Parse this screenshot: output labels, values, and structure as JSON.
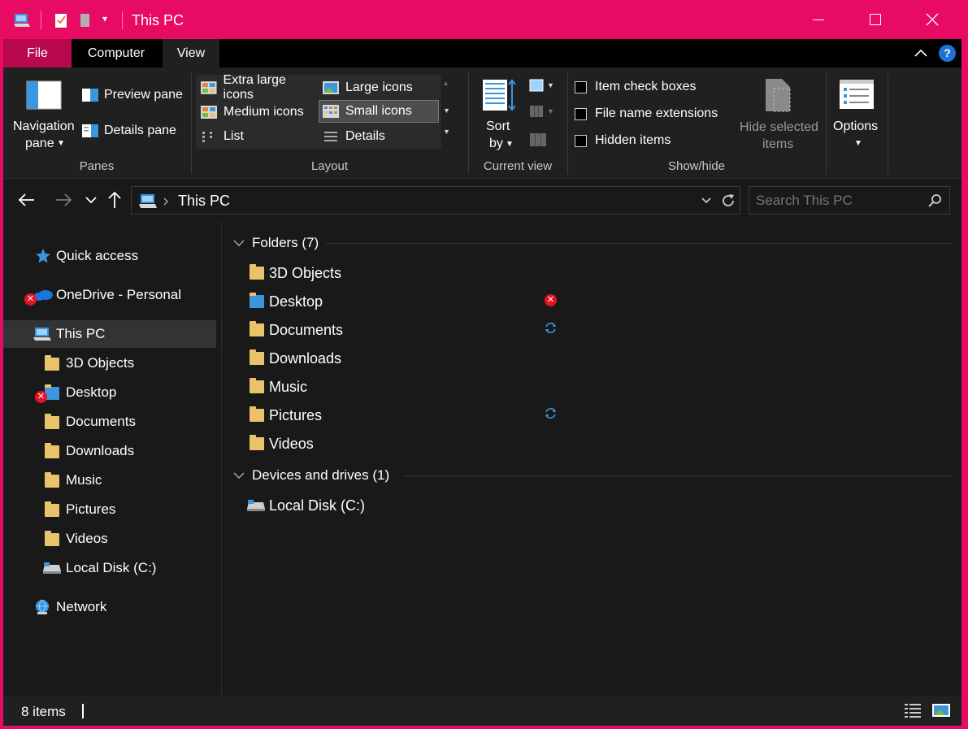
{
  "titlebar": {
    "title": "This PC",
    "minimize": "—",
    "maximize": "☐",
    "close": "✕"
  },
  "menu": {
    "tabs": [
      "File",
      "Computer",
      "View"
    ],
    "active_tab": "View"
  },
  "ribbon": {
    "panes": {
      "navigation_pane": "Navigation",
      "navigation_pane_2": "pane",
      "preview_pane": "Preview pane",
      "details_pane": "Details pane",
      "group_label": "Panes"
    },
    "layout": {
      "items": [
        "Extra large icons",
        "Large icons",
        "Medium icons",
        "Small icons",
        "List",
        "Details"
      ],
      "selected": "Small icons",
      "group_label": "Layout"
    },
    "current_view": {
      "sort_by": "Sort",
      "sort_by_2": "by",
      "group_label": "Current view"
    },
    "show_hide": {
      "item_check_boxes": "Item check boxes",
      "file_name_extensions": "File name extensions",
      "hidden_items": "Hidden items",
      "hide_selected": "Hide selected",
      "hide_selected_2": "items",
      "group_label": "Show/hide"
    },
    "options": {
      "label": "Options"
    }
  },
  "address": {
    "path": "This PC",
    "search_placeholder": "Search This PC"
  },
  "sidebar": {
    "items": [
      {
        "label": "Quick access",
        "icon": "star-icon"
      },
      {
        "label": "OneDrive - Personal",
        "icon": "cloud-icon",
        "status": "error"
      },
      {
        "label": "This PC",
        "icon": "computer-icon",
        "selected": true
      },
      {
        "label": "3D Objects",
        "icon": "folder-icon"
      },
      {
        "label": "Desktop",
        "icon": "folder-icon",
        "status": "error"
      },
      {
        "label": "Documents",
        "icon": "folder-icon"
      },
      {
        "label": "Downloads",
        "icon": "folder-icon"
      },
      {
        "label": "Music",
        "icon": "folder-icon"
      },
      {
        "label": "Pictures",
        "icon": "folder-icon"
      },
      {
        "label": "Videos",
        "icon": "folder-icon"
      },
      {
        "label": "Local Disk (C:)",
        "icon": "drive-icon"
      },
      {
        "label": "Network",
        "icon": "network-icon"
      }
    ]
  },
  "main": {
    "folders_header": "Folders (7)",
    "folders": [
      {
        "label": "3D Objects",
        "status": ""
      },
      {
        "label": "Desktop",
        "status": "error"
      },
      {
        "label": "Documents",
        "status": "sync"
      },
      {
        "label": "Downloads",
        "status": ""
      },
      {
        "label": "Music",
        "status": ""
      },
      {
        "label": "Pictures",
        "status": "sync"
      },
      {
        "label": "Videos",
        "status": ""
      }
    ],
    "drives_header": "Devices and drives (1)",
    "drives": [
      {
        "label": "Local Disk (C:)"
      }
    ]
  },
  "statusbar": {
    "item_count": "8 items"
  },
  "colors": {
    "accent": "#e80b63",
    "background": "#191919",
    "ribbon": "#202020",
    "error": "#e81123",
    "sync": "#3a96dd"
  }
}
